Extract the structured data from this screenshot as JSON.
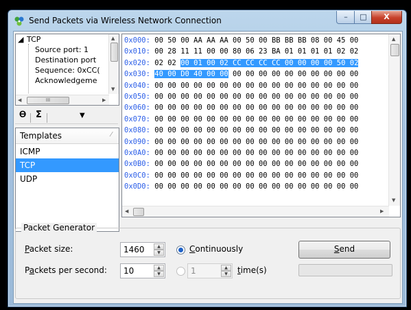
{
  "window": {
    "title": "Send Packets via  Wireless Network Connection",
    "minimize_glyph": "–",
    "maximize_glyph": "□",
    "close_glyph": "X",
    "app_icon": "network-adapter-icon"
  },
  "tree": {
    "root_label": "TCP",
    "items": [
      "Source port: 1",
      "Destination port",
      "Sequence: 0xCC(",
      "Acknowledgeme"
    ],
    "scroll_glyph": "III"
  },
  "toolbar": {
    "filter_icon": "funnel-icon",
    "sum_icon": "sigma-icon",
    "dropdown_icon": "chevron-down-icon"
  },
  "templates": {
    "header": "Templates",
    "items": [
      "ICMP",
      "TCP",
      "UDP"
    ],
    "selected": "TCP"
  },
  "hex": {
    "lines": [
      {
        "addr": "0x000:",
        "pre": " 00 50 00 AA AA AA 00 50 00 BB BB BB 08 00 45 00",
        "sel": "",
        "post": ""
      },
      {
        "addr": "0x010:",
        "pre": " 00 28 11 11 00 00 80 06 23 BA 01 01 01 01 02 02",
        "sel": "",
        "post": ""
      },
      {
        "addr": "0x020:",
        "pre": " 02 02 ",
        "sel": "00 01 00 02 CC CC CC CC 00 00 00 00 50 02",
        "post": ""
      },
      {
        "addr": "0x030:",
        "pre": " ",
        "sel": "40 00 D0 40 00 00",
        "post": " 00 00 00 00 00 00 00 00 00 00"
      },
      {
        "addr": "0x040:",
        "pre": " 00 00 00 00 00 00 00 00 00 00 00 00 00 00 00 00",
        "sel": "",
        "post": ""
      },
      {
        "addr": "0x050:",
        "pre": " 00 00 00 00 00 00 00 00 00 00 00 00 00 00 00 00",
        "sel": "",
        "post": ""
      },
      {
        "addr": "0x060:",
        "pre": " 00 00 00 00 00 00 00 00 00 00 00 00 00 00 00 00",
        "sel": "",
        "post": ""
      },
      {
        "addr": "0x070:",
        "pre": " 00 00 00 00 00 00 00 00 00 00 00 00 00 00 00 00",
        "sel": "",
        "post": ""
      },
      {
        "addr": "0x080:",
        "pre": " 00 00 00 00 00 00 00 00 00 00 00 00 00 00 00 00",
        "sel": "",
        "post": ""
      },
      {
        "addr": "0x090:",
        "pre": " 00 00 00 00 00 00 00 00 00 00 00 00 00 00 00 00",
        "sel": "",
        "post": ""
      },
      {
        "addr": "0x0A0:",
        "pre": " 00 00 00 00 00 00 00 00 00 00 00 00 00 00 00 00",
        "sel": "",
        "post": ""
      },
      {
        "addr": "0x0B0:",
        "pre": " 00 00 00 00 00 00 00 00 00 00 00 00 00 00 00 00",
        "sel": "",
        "post": ""
      },
      {
        "addr": "0x0C0:",
        "pre": " 00 00 00 00 00 00 00 00 00 00 00 00 00 00 00 00",
        "sel": "",
        "post": ""
      },
      {
        "addr": "0x0D0:",
        "pre": " 00 00 00 00 00 00 00 00 00 00 00 00 00 00 00 00",
        "sel": "",
        "post": ""
      }
    ]
  },
  "generator": {
    "group_title": "Packet Generator",
    "packet_size_label": "Packet size:",
    "packet_size_value": "1460",
    "pps_label": "Packets per second:",
    "pps_value": "10",
    "continuously_label": "Continuously",
    "continuously_selected": true,
    "times_value": "1",
    "times_label": "time(s)",
    "send_label": "Send"
  },
  "colors": {
    "selection": "#3399ff",
    "hex_address": "#2b5ee8",
    "title_bar": "#a6c3e0"
  }
}
